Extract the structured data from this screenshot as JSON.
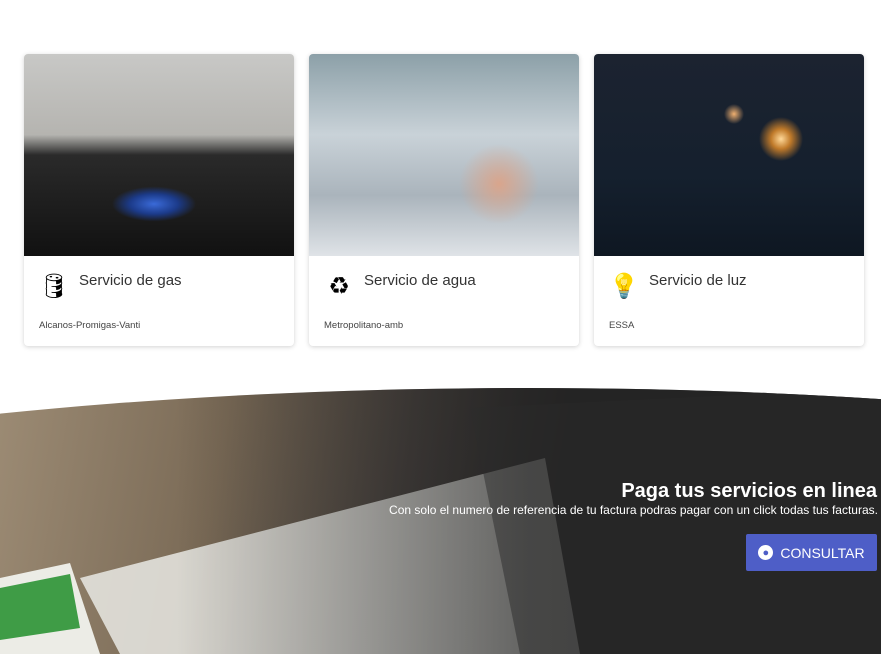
{
  "services": [
    {
      "title": "Servicio de gas",
      "provider": "Alcanos-Promigas-Vanti",
      "icon": "gas-cylinder-icon"
    },
    {
      "title": "Servicio de agua",
      "provider": "Metropolitano-amb",
      "icon": "water-recycle-icon"
    },
    {
      "title": "Servicio de luz",
      "provider": "ESSA",
      "icon": "lightbulb-house-icon"
    }
  ],
  "banner": {
    "title": "Paga tus servicios en linea",
    "text": "Con solo el numero de referencia de tu factura podras pagar con un click todas tus facturas.",
    "button": "CONSULTAR",
    "button_icon": "globe-icon",
    "button_color": "#4e5ec7"
  }
}
